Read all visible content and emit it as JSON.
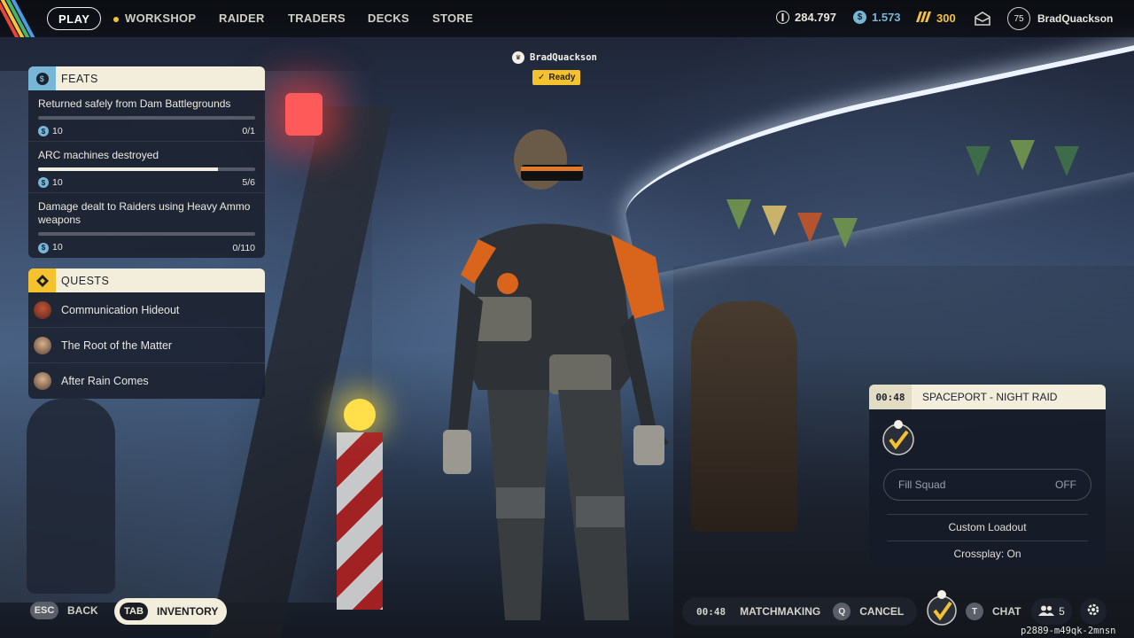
{
  "nav": {
    "play": "PLAY",
    "items": [
      "WORKSHOP",
      "RAIDER",
      "TRADERS",
      "DECKS",
      "STORE"
    ],
    "active_dot_color": "#f5c23a"
  },
  "currencies": [
    {
      "icon": "coins-icon",
      "value": "284.797"
    },
    {
      "icon": "credits-icon",
      "value": "1.573",
      "color": "#78b6d8"
    },
    {
      "icon": "raider-tokens-icon",
      "value": "300",
      "color": "#f5c23a"
    }
  ],
  "profile": {
    "level": "75",
    "name": "BradQuackson"
  },
  "feats": {
    "title": "FEATS",
    "items": [
      {
        "title": "Returned safely from Dam Battlegrounds",
        "reward": "10",
        "progress": "0/1",
        "fraction": 0
      },
      {
        "title": "ARC machines destroyed",
        "reward": "10",
        "progress": "5/6",
        "fraction": 0.83
      },
      {
        "title": "Damage dealt to Raiders using Heavy Ammo weapons",
        "reward": "10",
        "progress": "0/110",
        "fraction": 0
      }
    ]
  },
  "quests": {
    "title": "QUESTS",
    "items": [
      {
        "name": "Communication Hideout"
      },
      {
        "name": "The Root of the Matter"
      },
      {
        "name": "After Rain Comes"
      }
    ]
  },
  "player_tag": {
    "name": "BradQuackson",
    "status": "Ready"
  },
  "matchmaking_card": {
    "timer": "00:48",
    "map": "SPACEPORT - NIGHT RAID",
    "fill_squad_label": "Fill Squad",
    "fill_squad_value": "OFF",
    "custom_loadout": "Custom Loadout",
    "crossplay": "Crossplay: On"
  },
  "bottom": {
    "esc_key": "ESC",
    "back": "BACK",
    "tab_key": "TAB",
    "inventory": "INVENTORY",
    "mm_timer": "00:48",
    "matchmaking": "MATCHMAKING",
    "cancel_key": "Q",
    "cancel": "CANCEL",
    "chat_key": "T",
    "chat": "CHAT",
    "friends_count": "5",
    "build": "p2889-m49qk-2mnsn"
  },
  "colors": {
    "accent": "#f5c22f",
    "panel_header": "#f3eedc",
    "credit_blue": "#78b6d8"
  }
}
